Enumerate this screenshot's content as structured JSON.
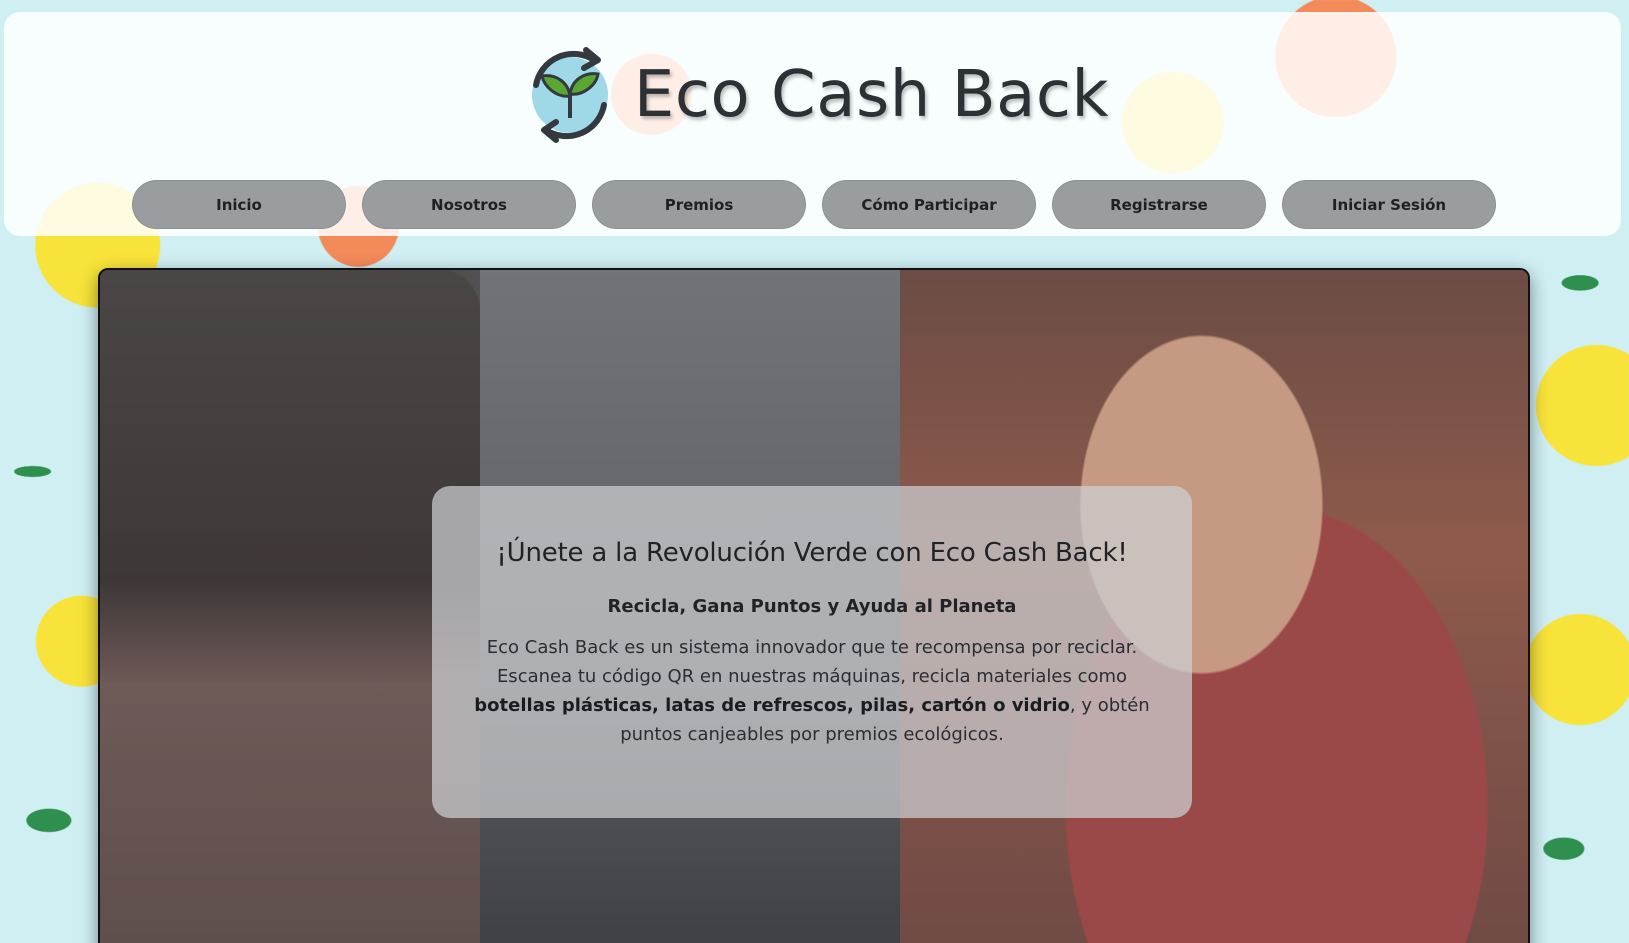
{
  "brand": {
    "name": "Eco Cash Back",
    "logo_icon": "leaf-recycle-icon"
  },
  "nav": {
    "items": [
      {
        "label": "Inicio"
      },
      {
        "label": "Nosotros"
      },
      {
        "label": "Premios"
      },
      {
        "label": "Cómo Participar"
      },
      {
        "label": "Registrarse"
      },
      {
        "label": "Iniciar Sesión"
      }
    ]
  },
  "hero": {
    "title": "¡Únete a la Revolución Verde con Eco Cash Back!",
    "subtitle": "Recicla, Gana Puntos y Ayuda al Planeta",
    "text_before": "Eco Cash Back es un sistema innovador que te recompensa por reciclar. Escanea tu código QR en nuestras máquinas, recicla materiales como ",
    "text_bold": "botellas plásticas, latas de refrescos, pilas, cartón o vidrio",
    "text_after": ", y obtén puntos canjeables por premios ecológicos."
  },
  "colors": {
    "background": "#cfeff3",
    "nav_button": "#9a9d9f",
    "title_text": "#2c3136",
    "logo_green": "#5aa832",
    "logo_blue": "#9fd8e6"
  }
}
